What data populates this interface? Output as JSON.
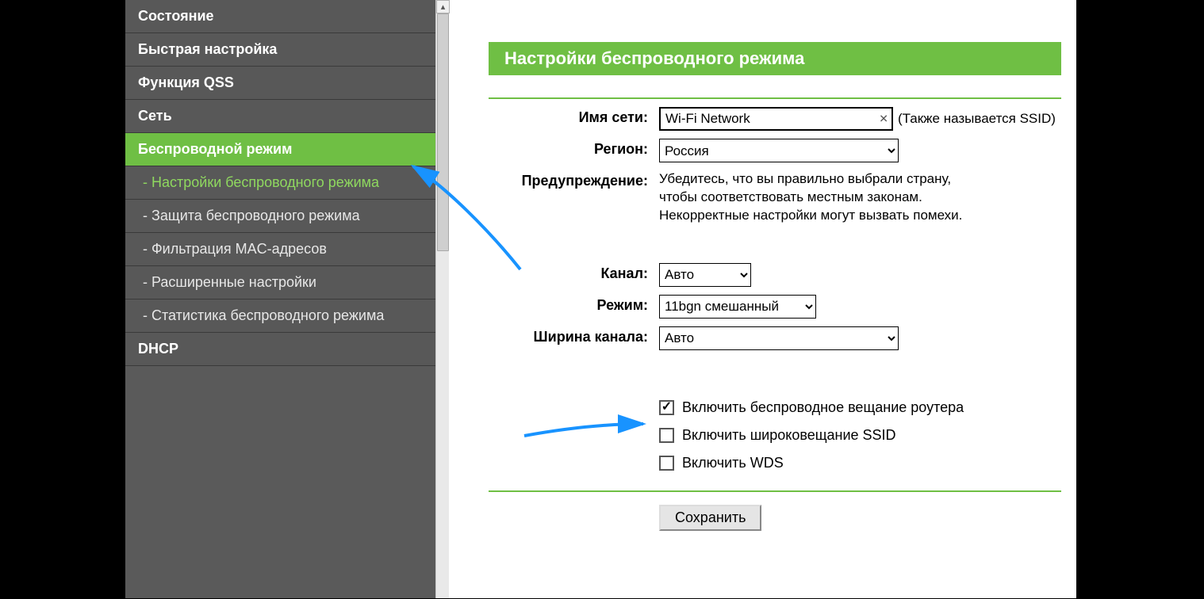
{
  "sidebar": {
    "items": [
      {
        "label": "Состояние",
        "type": "top"
      },
      {
        "label": "Быстрая настройка",
        "type": "top"
      },
      {
        "label": "Функция QSS",
        "type": "top"
      },
      {
        "label": "Сеть",
        "type": "top"
      },
      {
        "label": "Беспроводной режим",
        "type": "top",
        "active": true
      },
      {
        "label": "- Настройки беспроводного режима",
        "type": "sub",
        "subActive": true
      },
      {
        "label": "- Защита беспроводного режима",
        "type": "sub"
      },
      {
        "label": "- Фильтрация MAC-адресов",
        "type": "sub"
      },
      {
        "label": "- Расширенные настройки",
        "type": "sub"
      },
      {
        "label": "- Статистика беспроводного режима",
        "type": "sub"
      },
      {
        "label": "DHCP",
        "type": "top"
      }
    ]
  },
  "content": {
    "title": "Настройки беспроводного режима",
    "ssid": {
      "label": "Имя сети:",
      "value": "Wi-Fi Network",
      "hint": "(Также называется SSID)"
    },
    "region": {
      "label": "Регион:",
      "value": "Россия"
    },
    "warning": {
      "label": "Предупреждение:",
      "line1": "Убедитесь, что вы правильно выбрали страну,",
      "line2": "чтобы соответствовать местным законам.",
      "line3": "Некорректные настройки могут вызвать помехи."
    },
    "channel": {
      "label": "Канал:",
      "value": "Авто"
    },
    "mode": {
      "label": "Режим:",
      "value": "11bgn смешанный"
    },
    "width": {
      "label": "Ширина канала:",
      "value": "Авто"
    },
    "checkboxes": {
      "broadcast_router": {
        "label": "Включить беспроводное вещание роутера",
        "checked": true
      },
      "broadcast_ssid": {
        "label": "Включить широковещание SSID",
        "checked": false
      },
      "wds": {
        "label": "Включить WDS",
        "checked": false
      }
    },
    "save": "Сохранить"
  }
}
